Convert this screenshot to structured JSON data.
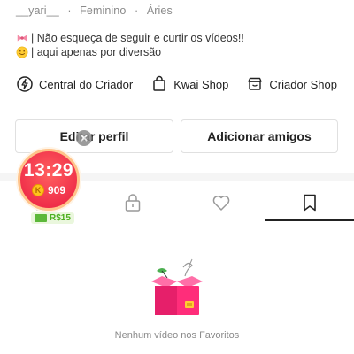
{
  "profile": {
    "username": "__yari__",
    "gender": "Feminino",
    "sign": "Áries",
    "separator": "·",
    "bio_line1": "| Não esqueça de seguir e curtir os vídeos!!",
    "bio_line2": "| aqui apenas por diversão"
  },
  "links": [
    {
      "label": "Central do Criador",
      "icon": "creator-bolt-icon"
    },
    {
      "label": "Kwai Shop",
      "icon": "shopping-bag-icon"
    },
    {
      "label": "Criador Shop",
      "icon": "shop-store-icon"
    }
  ],
  "buttons": {
    "edit_profile": "Editar perfil",
    "add_friends": "Adicionar amigos"
  },
  "tabs": [
    {
      "name": "videos",
      "icon": "grid-icon"
    },
    {
      "name": "private",
      "icon": "lock-icon"
    },
    {
      "name": "likes",
      "icon": "heart-icon"
    },
    {
      "name": "favorites",
      "icon": "bookmark-icon",
      "active": true
    }
  ],
  "timer_widget": {
    "time": "13:29",
    "coins": "909",
    "coin_symbol": "K",
    "reward": "R$15"
  },
  "empty_state": {
    "message": "Nenhum vídeo nos Favoritos"
  },
  "colors": {
    "accent": "#f0304a",
    "empty_box": "#ff2d7a",
    "reward_green": "#4caf20"
  }
}
